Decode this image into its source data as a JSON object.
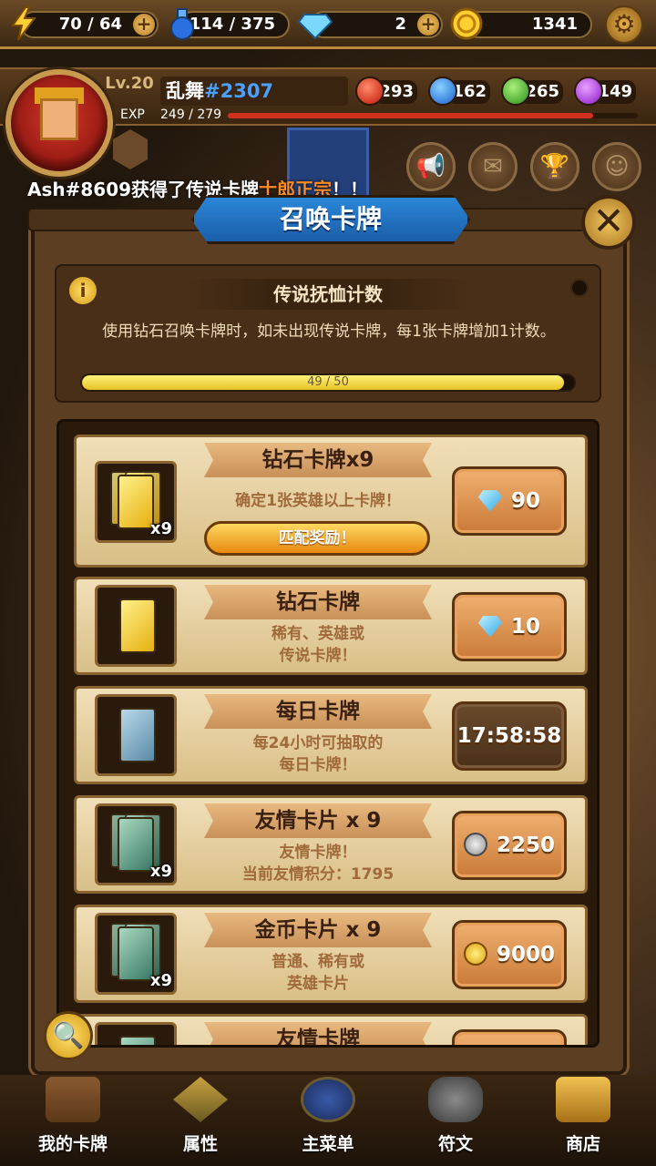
{
  "resources": {
    "energy": "70 / 64",
    "potion": "114 / 375",
    "diamonds": "2",
    "gold": "1341"
  },
  "player": {
    "level": "Lv.20",
    "name": "乱舞",
    "tag": "#2307",
    "exp_label": "EXP",
    "exp_value": "249 / 279",
    "exp_fraction": 0.892,
    "gems": {
      "red": "293",
      "blue": "162",
      "green": "265",
      "purple": "149"
    }
  },
  "ticker": {
    "prefix": "Ash#8609获得了传说卡牌",
    "highlight": "士郎正宗",
    "suffix": "！！"
  },
  "dialog": {
    "title": "召唤卡牌",
    "close_icon": "close-icon",
    "pity": {
      "title": "传说抚恤计数",
      "description": "使用钻石召唤卡牌时，如未出现传说卡牌，每1张卡牌增加1计数。",
      "progress_text": "49 / 50",
      "progress_fraction": 0.98
    },
    "cards": [
      {
        "title": "钻石卡牌x9",
        "desc": "确定1张英雄以上卡牌！",
        "bonus": "匹配奖励！",
        "count": "x9",
        "card_type": "gold",
        "price_icon": "diamond",
        "price": "90"
      },
      {
        "title": "钻石卡牌",
        "desc_line1": "稀有、英雄或",
        "desc_line2": "传说卡牌！",
        "card_type": "gold",
        "price_icon": "diamond",
        "price": "10"
      },
      {
        "title": "每日卡牌",
        "desc_line1": "每24小时可抽取的",
        "desc_line2": "每日卡牌！",
        "card_type": "silver",
        "timer": "17:58:58"
      },
      {
        "title": "友情卡片 x 9",
        "desc_line1": "友情卡牌！",
        "desc_line2": "当前友情积分：1795",
        "count": "x9",
        "card_type": "green",
        "price_icon": "silver-coin",
        "price": "2250"
      },
      {
        "title": "金币卡片 x 9",
        "desc_line1": "普通、稀有或",
        "desc_line2": "英雄卡片",
        "count": "x9",
        "card_type": "green",
        "price_icon": "gold-coin",
        "price": "9000"
      },
      {
        "title": "友情卡牌",
        "card_type": "green"
      }
    ]
  },
  "bottom_nav": [
    {
      "label": "我的卡牌"
    },
    {
      "label": "属性"
    },
    {
      "label": "主菜单"
    },
    {
      "label": "符文"
    },
    {
      "label": "商店"
    }
  ],
  "colors": {
    "accent_blue": "#2b86d8",
    "gold": "#e6c224",
    "ticker_highlight": "#ff8a20",
    "tag_blue": "#4aa0ff"
  }
}
